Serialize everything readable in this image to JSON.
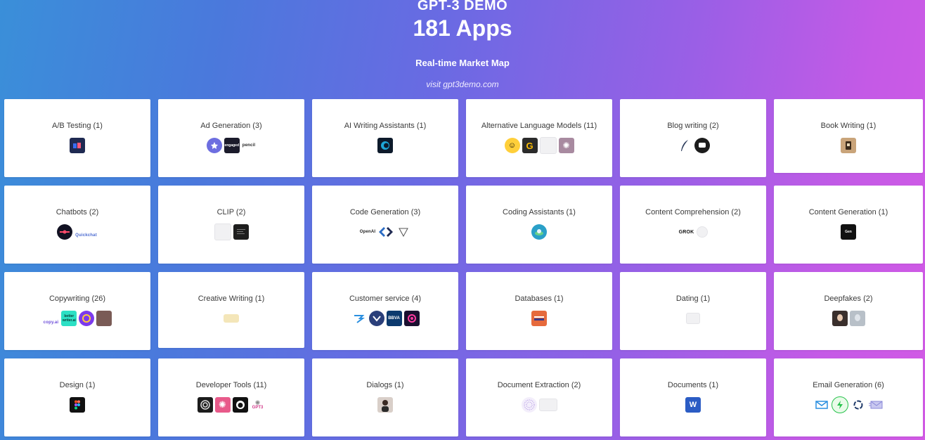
{
  "header": {
    "eyebrow": "GPT-3 DEMO",
    "headline": "181 Apps",
    "subhead": "Real-time Market Map",
    "visit": "visit gpt3demo.com"
  },
  "categories": [
    {
      "title": "A/B Testing (1)",
      "logos": [
        {
          "name": "ab-testing-app-logo",
          "color": "#1f2a52"
        }
      ]
    },
    {
      "title": "Ad Generation (3)",
      "logos": [
        {
          "name": "ad-gen-badge-logo",
          "color": "#6d6ee0"
        },
        {
          "name": "ad-gen-dark-logo",
          "color": "#1b1b2b"
        },
        {
          "name": "pencil-logo",
          "text": "pencil"
        }
      ]
    },
    {
      "title": "AI Writing Assistants (1)",
      "logos": [
        {
          "name": "writing-assistant-logo",
          "color": "#0d1a2b"
        }
      ]
    },
    {
      "title": "Alternative Language Models (11)",
      "logos": [
        {
          "name": "hugging-face-logo",
          "color": "#ffcf3a"
        },
        {
          "name": "google-bert-logo",
          "color": "#2b2b2b"
        },
        {
          "name": "model-ghost-logo",
          "color": "#f1f1f3"
        },
        {
          "name": "openai-logo",
          "color": "#a88aa0"
        }
      ]
    },
    {
      "title": "Blog writing (2)",
      "logos": [
        {
          "name": "quill-logo",
          "color": "#ffffff"
        },
        {
          "name": "blog-dark-logo",
          "color": "#1c1c1c"
        }
      ]
    },
    {
      "title": "Book Writing (1)",
      "logos": [
        {
          "name": "book-writing-logo",
          "color": "#c9a47a"
        }
      ]
    },
    {
      "title": "Chatbots (2)",
      "logos": [
        {
          "name": "chatbot-circle-logo",
          "color": "#111122"
        },
        {
          "name": "quickchat-logo",
          "text": "Quickchat"
        }
      ]
    },
    {
      "title": "CLIP (2)",
      "logos": [
        {
          "name": "clip-ghost-logo",
          "color": "#f1f1f3"
        },
        {
          "name": "clip-dark-logo",
          "color": "#1d1d1d"
        }
      ]
    },
    {
      "title": "Code Generation (3)",
      "logos": [
        {
          "name": "openai-codex-logo",
          "text": "OpenAI"
        },
        {
          "name": "code-arrows-logo",
          "color": "#2b6cc4"
        },
        {
          "name": "code-triangle-logo",
          "color": "#ffffff"
        }
      ]
    },
    {
      "title": "Coding Assistants (1)",
      "logos": [
        {
          "name": "coding-assistant-logo",
          "color": "#2aa0c8"
        }
      ]
    },
    {
      "title": "Content Comprehension (2)",
      "logos": [
        {
          "name": "grok-logo",
          "text": "GROK"
        },
        {
          "name": "comprehension-ghost-logo",
          "color": "#f1f1f3"
        }
      ]
    },
    {
      "title": "Content Generation (1)",
      "logos": [
        {
          "name": "content-gen-logo",
          "color": "#111111"
        }
      ]
    },
    {
      "title": "Copywriting (26)",
      "logos": [
        {
          "name": "copy-ai-logo",
          "text": "copy.ai"
        },
        {
          "name": "better-writer-logo",
          "color": "#2ce0c5",
          "text": "better writer.ai"
        },
        {
          "name": "copy-circle-logo",
          "color": "#7c3aed"
        },
        {
          "name": "copy-photo-logo",
          "color": "#7a5b56"
        }
      ]
    },
    {
      "title": "Creative Writing (1)",
      "logos": [
        {
          "name": "creative-writing-logo",
          "color": "#f4e6b9"
        }
      ]
    },
    {
      "title": "Customer service (4)",
      "logos": [
        {
          "name": "service-wave-logo",
          "color": "#ffffff"
        },
        {
          "name": "service-chevron-logo",
          "color": "#2a3f7a"
        },
        {
          "name": "bbva-logo",
          "color": "#0c3a6e",
          "text": "BBVA"
        },
        {
          "name": "service-ring-logo",
          "color": "#1a1030"
        }
      ]
    },
    {
      "title": "Databases (1)",
      "logos": [
        {
          "name": "database-logo",
          "color": "#e66a3c"
        }
      ]
    },
    {
      "title": "Dating (1)",
      "logos": [
        {
          "name": "dating-ghost-logo",
          "color": "#f1f1f3"
        }
      ]
    },
    {
      "title": "Deepfakes (2)",
      "logos": [
        {
          "name": "deepfake-face-logo",
          "color": "#3a2f2c"
        },
        {
          "name": "deepfake-sketch-logo",
          "color": "#b8c0c8"
        }
      ]
    },
    {
      "title": "Design (1)",
      "logos": [
        {
          "name": "figma-logo",
          "color": "#111111"
        }
      ]
    },
    {
      "title": "Developer Tools (11)",
      "logos": [
        {
          "name": "devtool-swirl-logo",
          "color": "#1c1c1c"
        },
        {
          "name": "devtool-openai-logo",
          "color": "#e85a8a"
        },
        {
          "name": "github-logo",
          "color": "#111111"
        },
        {
          "name": "gpt3-logo",
          "color": "#ffffff",
          "text": "GPT3"
        }
      ]
    },
    {
      "title": "Dialogs (1)",
      "logos": [
        {
          "name": "dialogs-avatar-logo",
          "color": "#d9cfc9"
        }
      ]
    },
    {
      "title": "Document Extraction (2)",
      "logos": [
        {
          "name": "extraction-dots-logo",
          "color": "#f3eefb"
        },
        {
          "name": "extraction-ghost-logo",
          "color": "#f1f1f3"
        }
      ]
    },
    {
      "title": "Documents (1)",
      "logos": [
        {
          "name": "word-logo",
          "color": "#2b5cc4"
        }
      ]
    },
    {
      "title": "Email Generation (6)",
      "logos": [
        {
          "name": "email-envelope-logo",
          "color": "#ffffff"
        },
        {
          "name": "email-bolt-logo",
          "color": "#27c24c"
        },
        {
          "name": "email-spinner-logo",
          "color": "#ffffff"
        },
        {
          "name": "email-airmail-logo",
          "color": "#ffffff"
        }
      ]
    }
  ]
}
